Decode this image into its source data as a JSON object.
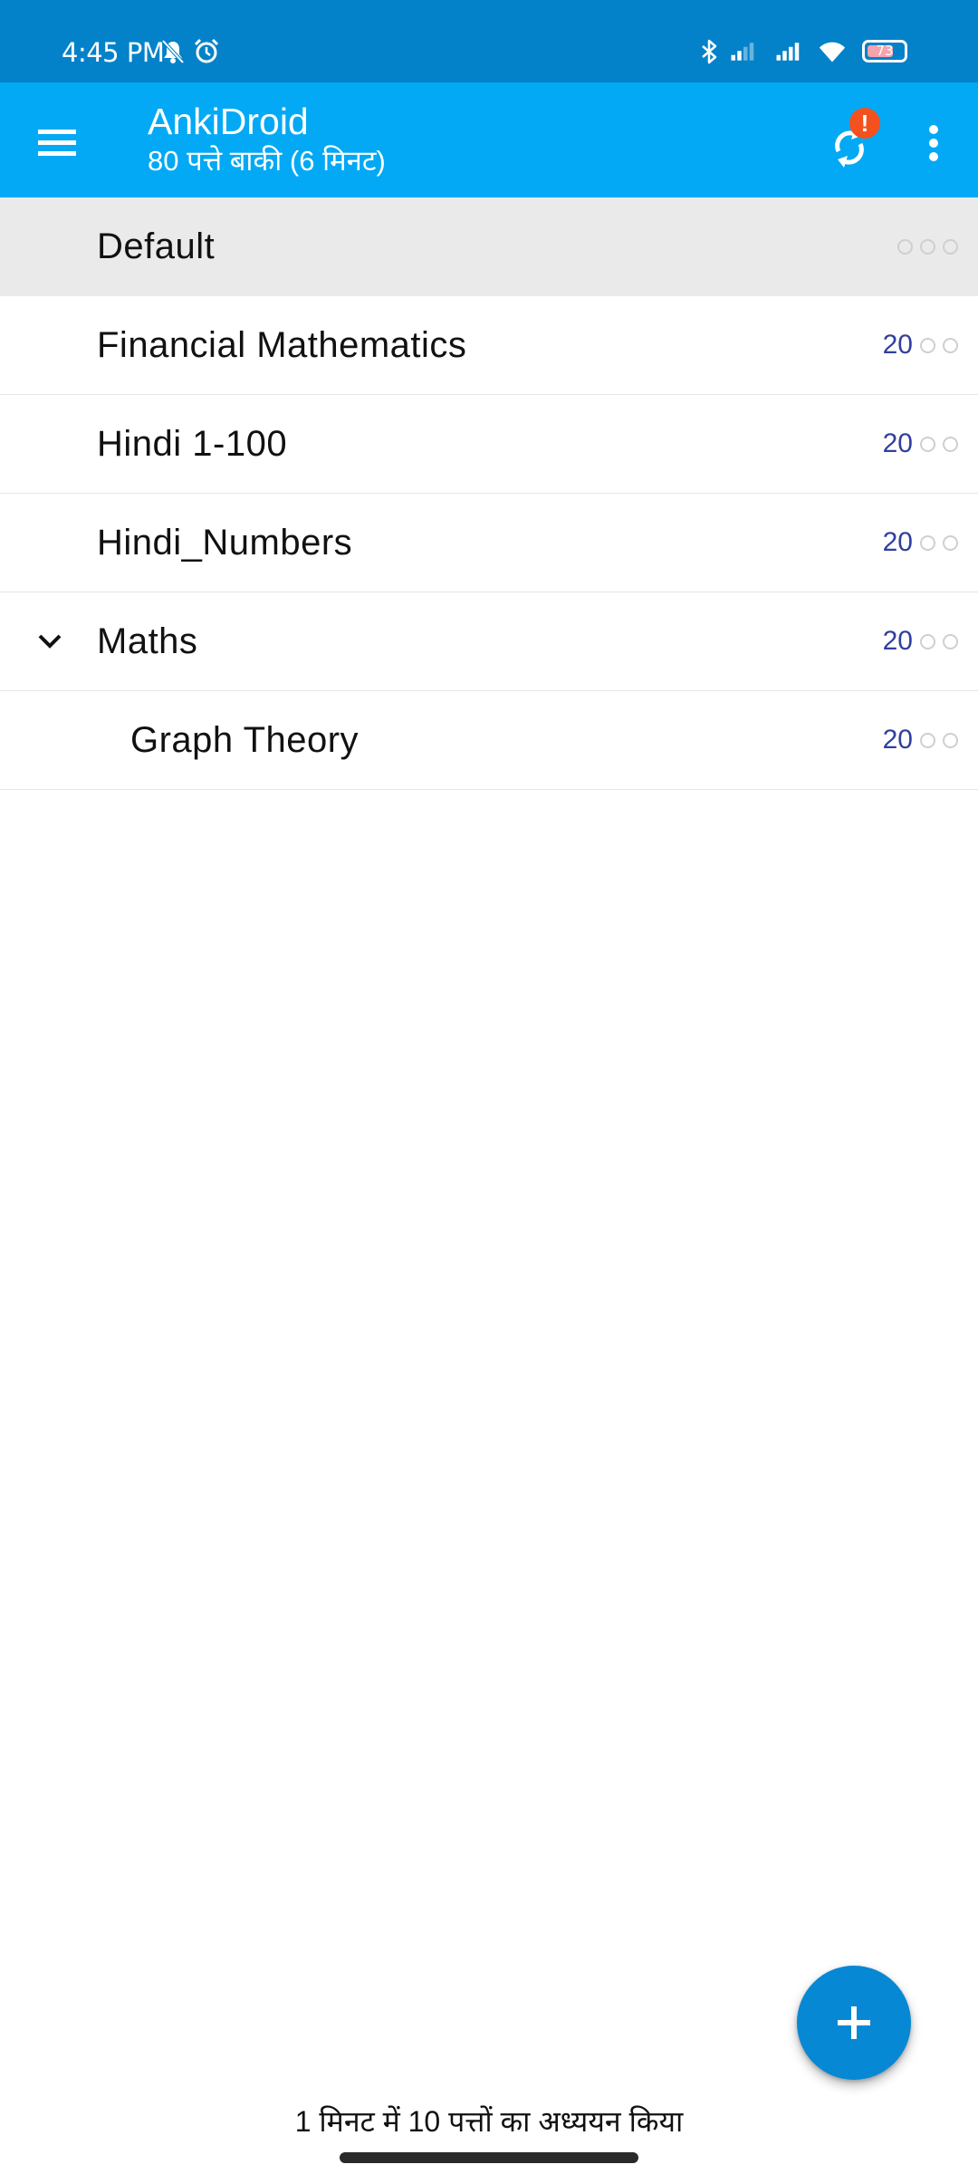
{
  "status_bar": {
    "time": "4:45 PM",
    "battery_level": "73",
    "battery_fraction": 0.73,
    "icons": [
      "mute-icon",
      "alarm-icon",
      "bluetooth-icon",
      "signal-weak-icon",
      "signal-strong-icon",
      "wifi-icon",
      "battery-icon"
    ]
  },
  "app_bar": {
    "title": "AnkiDroid",
    "subtitle": "80 पत्ते बाकी (6 मिनट)",
    "sync_badge": "!",
    "icons": [
      "menu-icon",
      "sync-icon",
      "more-vertical-icon"
    ]
  },
  "decks": [
    {
      "name": "Default",
      "new": "",
      "learn": "0",
      "review": "0",
      "selected": true
    },
    {
      "name": "Financial Mathematics",
      "new": "20",
      "learn": "0",
      "review": "0"
    },
    {
      "name": "Hindi 1-100",
      "new": "20",
      "learn": "0",
      "review": "0"
    },
    {
      "name": "Hindi_Numbers",
      "new": "20",
      "learn": "0",
      "review": "0"
    },
    {
      "name": "Maths",
      "new": "20",
      "learn": "0",
      "review": "0",
      "expanded": true
    },
    {
      "name": "Graph Theory",
      "new": "20",
      "learn": "0",
      "review": "0",
      "child": true
    }
  ],
  "fab": {
    "icon": "plus-icon"
  },
  "footer": {
    "studied_text": "1 मिनट में 10 पत्तों का अध्ययन किया"
  },
  "colors": {
    "status_bar": "#0482c9",
    "app_bar": "#03a9f4",
    "fab": "#0788d4",
    "new_count": "#303f9f",
    "sync_badge": "#f4511e",
    "selected_row": "#eaeaea"
  }
}
